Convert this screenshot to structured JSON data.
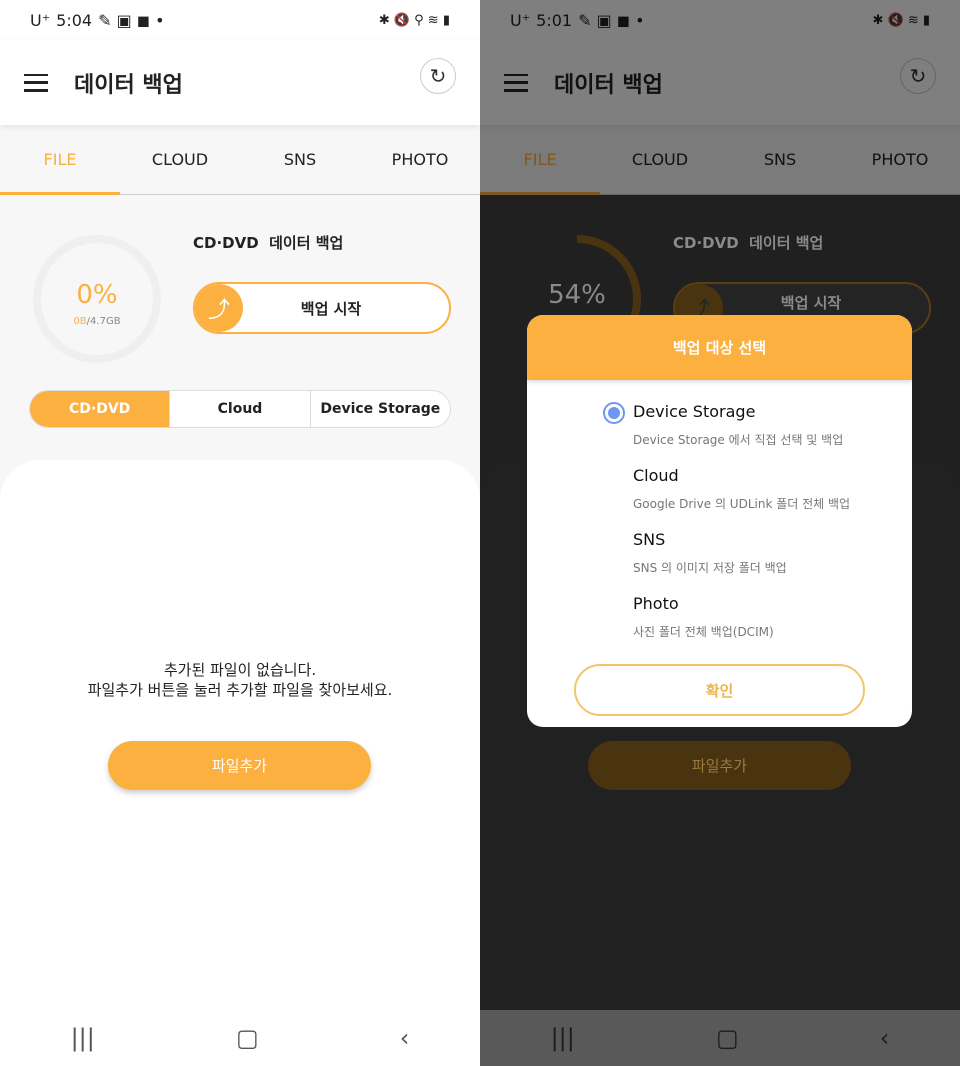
{
  "accent": "#fbb040",
  "left": {
    "status": {
      "carrier": "U⁺",
      "time": "5:04",
      "icons": "bluetooth mute location wifi signal battery"
    },
    "appbar": {
      "title": "데이터 백업"
    },
    "tabs": [
      "FILE",
      "CLOUD",
      "SNS",
      "PHOTO"
    ],
    "progress": {
      "percent_label": "0%",
      "percent": 0,
      "used": "0B",
      "total": "/4.7GB"
    },
    "subtitle": "CD·DVD  데이터 백업",
    "start_label": "백업 시작",
    "segments": [
      "CD·DVD",
      "Cloud",
      "Device Storage"
    ],
    "empty_line1": "추가된 파일이 없습니다.",
    "empty_line2": "파일추가 버튼을 눌러 추가할 파일을 찾아보세요.",
    "add_label": "파일추가"
  },
  "right": {
    "status": {
      "carrier": "U⁺",
      "time": "5:01"
    },
    "appbar": {
      "title": "데이터 백업"
    },
    "tabs": [
      "FILE",
      "CLOUD",
      "SNS",
      "PHOTO"
    ],
    "progress": {
      "percent_label": "54%",
      "percent": 54
    },
    "subtitle": "CD·DVD  데이터 백업",
    "start_label": "백업 시작",
    "add_label": "파일추가",
    "dialog": {
      "title": "백업 대상 선택",
      "selected": "Device Storage",
      "options": [
        {
          "name": "Device Storage",
          "desc": "Device Storage 에서 직접 선택 및 백업"
        },
        {
          "name": "Cloud",
          "desc": "Google Drive 의 UDLink 폴더 전체 백업"
        },
        {
          "name": "SNS",
          "desc": "SNS 의 이미지 저장 폴더 백업"
        },
        {
          "name": "Photo",
          "desc": "사진 폴더 전체 백업(DCIM)"
        }
      ],
      "confirm": "확인"
    }
  }
}
